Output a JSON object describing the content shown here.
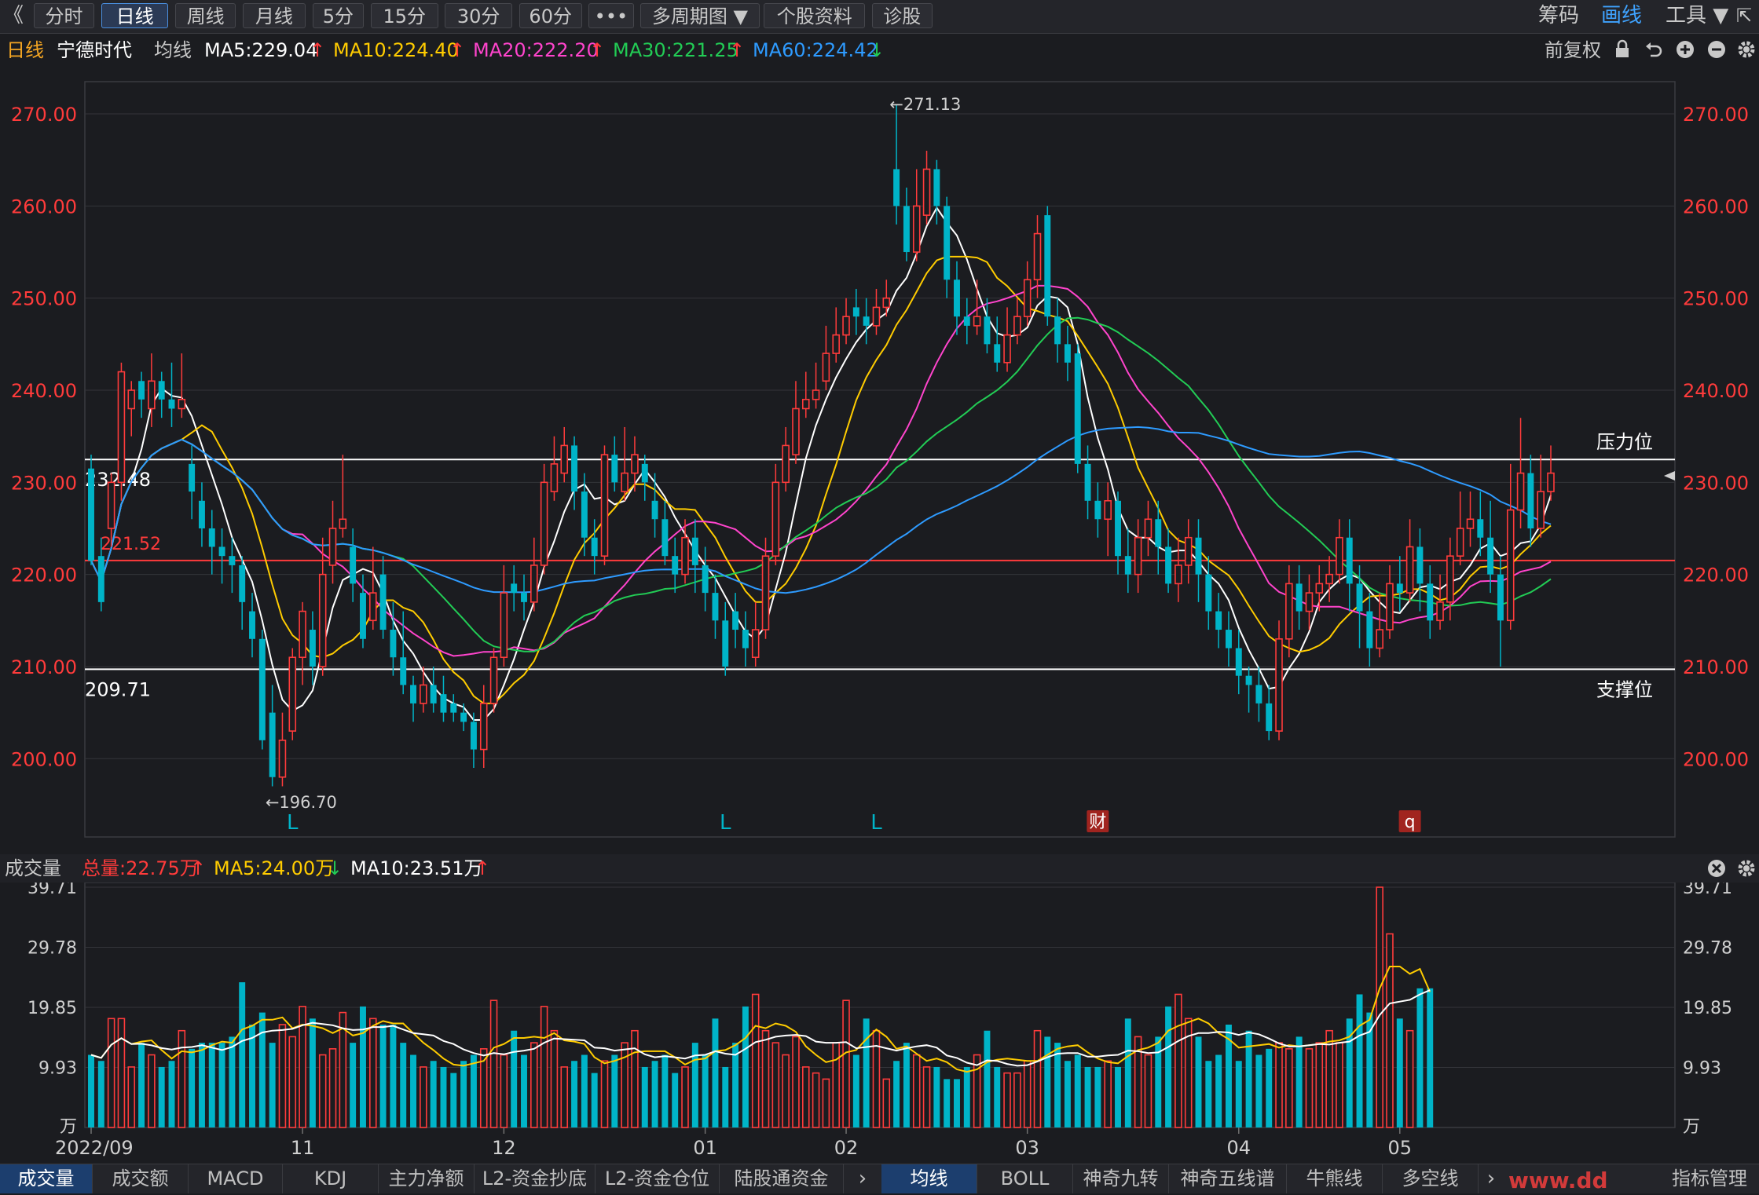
{
  "toolbar": {
    "back_glyph": "《",
    "buttons": [
      "分时",
      "日线",
      "周线",
      "月线",
      "5分",
      "15分",
      "30分",
      "60分",
      "•••",
      "多周期图 ▼",
      "个股资料",
      "诊股"
    ],
    "active_index": 1,
    "right": [
      "筹码",
      "画线",
      "工具 ▼"
    ],
    "right_active_index": 1
  },
  "info": {
    "period": "日线",
    "stock_name": "宁德时代",
    "ma_label": "均线",
    "ma5": "MA5:229.04",
    "ma10": "MA10:224.40",
    "ma20": "MA20:222.20",
    "ma30": "MA30:221.25",
    "ma60": "MA60:224.42",
    "adjust": "前复权"
  },
  "volume_info": {
    "label": "成交量",
    "total": "总量:22.75万",
    "ma5": "MA5:24.00万",
    "ma10": "MA10:23.51万"
  },
  "bottom_tabs_left": [
    "成交量",
    "成交额",
    "MACD",
    "KDJ",
    "主力净额",
    "L2-资金抄底",
    "L2-资金仓位",
    "陆股通资金"
  ],
  "bottom_tabs_right": [
    "均线",
    "BOLL",
    "神奇九转",
    "神奇五线谱",
    "牛熊线",
    "多空线"
  ],
  "bottom_tab_extra": "指标管理",
  "watermark": "www.dd",
  "colors": {
    "up": "#ff3b3b",
    "down": "#00b4c8",
    "ma5": "#ffffff",
    "ma10": "#ffcc00",
    "ma20": "#ff44cc",
    "ma30": "#22cc55",
    "ma60": "#2e9bff",
    "price_axis": "#ff3b3b"
  },
  "chart_data": [
    {
      "type": "candlestick",
      "y_ticks": [
        "270.00",
        "260.00",
        "250.00",
        "240.00",
        "230.00",
        "220.00",
        "210.00",
        "200.00"
      ],
      "ylim": [
        191.5,
        273.5
      ],
      "x_ticks": [
        {
          "label": "2022/09",
          "index": 0
        },
        {
          "label": "11",
          "index": 21
        },
        {
          "label": "12",
          "index": 41
        },
        {
          "label": "01",
          "index": 61
        },
        {
          "label": "02",
          "index": 75
        },
        {
          "label": "03",
          "index": 93
        },
        {
          "label": "04",
          "index": 114
        },
        {
          "label": "05",
          "index": 130
        }
      ],
      "candles": [
        [
          231.5,
          221.5,
          233,
          221
        ],
        [
          222,
          217,
          224,
          216
        ],
        [
          225,
          230,
          231,
          223
        ],
        [
          230,
          242,
          243,
          228
        ],
        [
          238,
          240,
          241,
          235
        ],
        [
          241,
          239,
          242,
          237
        ],
        [
          238,
          241,
          244,
          236
        ],
        [
          241,
          239,
          242,
          237
        ],
        [
          239,
          238,
          243,
          236
        ],
        [
          238,
          239,
          244,
          237
        ],
        [
          232,
          229,
          234,
          226
        ],
        [
          228,
          225,
          230,
          223
        ],
        [
          225,
          223,
          227,
          220
        ],
        [
          223,
          222,
          225,
          219
        ],
        [
          222,
          221,
          224,
          218
        ],
        [
          221,
          217,
          222,
          214
        ],
        [
          216,
          213,
          218,
          211
        ],
        [
          213,
          202,
          214,
          201
        ],
        [
          205,
          198,
          208,
          197
        ],
        [
          198,
          202,
          205,
          197
        ],
        [
          203,
          211,
          212,
          202
        ],
        [
          211,
          216,
          217,
          208
        ],
        [
          214,
          210,
          216,
          208
        ],
        [
          210,
          220,
          224,
          209
        ],
        [
          221,
          225,
          228,
          219
        ],
        [
          225,
          226,
          233,
          224
        ],
        [
          223,
          219,
          225,
          217
        ],
        [
          218,
          213,
          220,
          212
        ],
        [
          215,
          218,
          223,
          214
        ],
        [
          220,
          214,
          222,
          213
        ],
        [
          214,
          211,
          217,
          209
        ],
        [
          211,
          208,
          216,
          207
        ],
        [
          208,
          206,
          209,
          204
        ],
        [
          206,
          208,
          210,
          205
        ],
        [
          208,
          206,
          210,
          205
        ],
        [
          207,
          205,
          209,
          204
        ],
        [
          206,
          205,
          207,
          204
        ],
        [
          205,
          204,
          206,
          203
        ],
        [
          204,
          201,
          205,
          199
        ],
        [
          201,
          206,
          208,
          199
        ],
        [
          206,
          211,
          212,
          205
        ],
        [
          211,
          218,
          221,
          210
        ],
        [
          219,
          218,
          221,
          216
        ],
        [
          218,
          217,
          220,
          215
        ],
        [
          217,
          221,
          224,
          216
        ],
        [
          221,
          230,
          232,
          220
        ],
        [
          229,
          232,
          235,
          228
        ],
        [
          231,
          234,
          236,
          230
        ],
        [
          234,
          229,
          235,
          227
        ],
        [
          229,
          224,
          231,
          222
        ],
        [
          224,
          222,
          226,
          220
        ],
        [
          222,
          233,
          234,
          221
        ],
        [
          233,
          230,
          235,
          229
        ],
        [
          229,
          231,
          236,
          228
        ],
        [
          231,
          233,
          235,
          229
        ],
        [
          232,
          230,
          233,
          228
        ],
        [
          228,
          226,
          231,
          224
        ],
        [
          226,
          222,
          228,
          221
        ],
        [
          222,
          220,
          224,
          218
        ],
        [
          220,
          224,
          226,
          219
        ],
        [
          224,
          221,
          226,
          218
        ],
        [
          221,
          218,
          223,
          216
        ],
        [
          218,
          215,
          220,
          213
        ],
        [
          215,
          210,
          217,
          209
        ],
        [
          216,
          214,
          218,
          212
        ],
        [
          214,
          212,
          216,
          210
        ],
        [
          211,
          214,
          217,
          210
        ],
        [
          214,
          222,
          224,
          213
        ],
        [
          222,
          230,
          232,
          221
        ],
        [
          230,
          234,
          236,
          229
        ],
        [
          233,
          238,
          241,
          232
        ],
        [
          238,
          239,
          242,
          237
        ],
        [
          239,
          240,
          243,
          238
        ],
        [
          241,
          244,
          247,
          240
        ],
        [
          244,
          246,
          249,
          243
        ],
        [
          246,
          248,
          250,
          245
        ],
        [
          249,
          248,
          251,
          246
        ],
        [
          248,
          247,
          250,
          245
        ],
        [
          247,
          249,
          251,
          246
        ],
        [
          249,
          250,
          252,
          248
        ],
        [
          264,
          260,
          271,
          258
        ],
        [
          260,
          255,
          262,
          254
        ],
        [
          255,
          260,
          264,
          254
        ],
        [
          259,
          264,
          266,
          258
        ],
        [
          264,
          260,
          265,
          258
        ],
        [
          260,
          252,
          261,
          250
        ],
        [
          252,
          248,
          254,
          246
        ],
        [
          248,
          247,
          250,
          245
        ],
        [
          247,
          248,
          252,
          246
        ],
        [
          248,
          245,
          250,
          244
        ],
        [
          245,
          243,
          248,
          242
        ],
        [
          243,
          246,
          249,
          242
        ],
        [
          246,
          248,
          250,
          245
        ],
        [
          248,
          252,
          254,
          247
        ],
        [
          252,
          257,
          259,
          250
        ],
        [
          259,
          248,
          260,
          247
        ],
        [
          248,
          245,
          250,
          243
        ],
        [
          245,
          243,
          247,
          241
        ],
        [
          244,
          232,
          245,
          231
        ],
        [
          232,
          228,
          234,
          226
        ],
        [
          228,
          226,
          230,
          224
        ],
        [
          226,
          228,
          230,
          222
        ],
        [
          228,
          222,
          229,
          220
        ],
        [
          222,
          220,
          225,
          218
        ],
        [
          220,
          224,
          226,
          218
        ],
        [
          224,
          226,
          228,
          222
        ],
        [
          226,
          223,
          228,
          220
        ],
        [
          223,
          219,
          225,
          218
        ],
        [
          219,
          221,
          224,
          217
        ],
        [
          221,
          224,
          226,
          219
        ],
        [
          224,
          220,
          226,
          217
        ],
        [
          220,
          216,
          222,
          214
        ],
        [
          216,
          214,
          218,
          212
        ],
        [
          214,
          212,
          216,
          210
        ],
        [
          212,
          209,
          214,
          207
        ],
        [
          209,
          208,
          210,
          205
        ],
        [
          208,
          206,
          210,
          204
        ],
        [
          206,
          203,
          208,
          202
        ],
        [
          203,
          213,
          215,
          202
        ],
        [
          213,
          219,
          221,
          211
        ],
        [
          219,
          216,
          221,
          214
        ],
        [
          216,
          218,
          220,
          214
        ],
        [
          218,
          219,
          221,
          216
        ],
        [
          219,
          220,
          222,
          217
        ],
        [
          220,
          224,
          226,
          219
        ],
        [
          224,
          219,
          226,
          216
        ],
        [
          219,
          216,
          221,
          212
        ],
        [
          216,
          212,
          218,
          210
        ],
        [
          212,
          214,
          218,
          211
        ],
        [
          214,
          219,
          221,
          213
        ],
        [
          219,
          218,
          222,
          216
        ],
        [
          218,
          223,
          226,
          217
        ],
        [
          223,
          219,
          225,
          216
        ],
        [
          219,
          215,
          221,
          213
        ],
        [
          215,
          217,
          220,
          214
        ],
        [
          217,
          222,
          224,
          215
        ],
        [
          222,
          225,
          229,
          221
        ],
        [
          225,
          226,
          229,
          223
        ],
        [
          226,
          224,
          229,
          222
        ],
        [
          224,
          220,
          228,
          218
        ],
        [
          220,
          215,
          222,
          210
        ],
        [
          215,
          227,
          232,
          214
        ],
        [
          227,
          231,
          237,
          225
        ],
        [
          231,
          225,
          233,
          223
        ],
        [
          225,
          229,
          233,
          224
        ],
        [
          229,
          231,
          234,
          228
        ]
      ],
      "hlines": [
        {
          "value": 232.48,
          "label": "232.48",
          "right_label": "压力位",
          "color": "#ffffff"
        },
        {
          "value": 221.52,
          "label": "221.52",
          "right_label": "",
          "color": "#ff3b3b"
        },
        {
          "value": 209.71,
          "label": "209.71",
          "right_label": "支撑位",
          "color": "#ffffff"
        }
      ],
      "annotations": [
        {
          "text": "←271.13",
          "index": 79,
          "value": 271.13
        },
        {
          "text": "←196.70",
          "index": 17,
          "value": 196.7
        }
      ],
      "markers": [
        {
          "text": "L",
          "index": 20,
          "type": "letter"
        },
        {
          "text": "L",
          "index": 63,
          "type": "letter"
        },
        {
          "text": "L",
          "index": 78,
          "type": "letter"
        },
        {
          "text": "财",
          "index": 100,
          "type": "badge"
        },
        {
          "text": "q",
          "index": 131,
          "type": "badge"
        }
      ],
      "ma": [
        {
          "name": "MA5",
          "period": 5,
          "color": "#ffffff"
        },
        {
          "name": "MA10",
          "period": 10,
          "color": "#ffcc00"
        },
        {
          "name": "MA20",
          "period": 20,
          "color": "#ff44cc"
        },
        {
          "name": "MA30",
          "period": 30,
          "color": "#22cc55"
        },
        {
          "name": "MA60",
          "period": 60,
          "color": "#2e9bff"
        }
      ]
    },
    {
      "type": "bar",
      "title": "成交量",
      "y_ticks": [
        "39.71",
        "29.78",
        "19.85",
        "9.93",
        "万"
      ],
      "ylim": [
        0,
        39.71
      ],
      "volumes": [
        12,
        11,
        18,
        18,
        10,
        14,
        12,
        10,
        11,
        16,
        13,
        14,
        14,
        14,
        15,
        24,
        17,
        19,
        14,
        17,
        15,
        20,
        18,
        12,
        13,
        19,
        14,
        20,
        18,
        17,
        17,
        14,
        12,
        10,
        11,
        10,
        9,
        11,
        12,
        13,
        21,
        12,
        16,
        12,
        14,
        20,
        16,
        10,
        11,
        12,
        9,
        11,
        12,
        14,
        16,
        10,
        11,
        12,
        9,
        10,
        14,
        12,
        18,
        10,
        14,
        20,
        22,
        16,
        14,
        12,
        15,
        10,
        9,
        8,
        14,
        21,
        12,
        18,
        16,
        8,
        11,
        14,
        12,
        10,
        10,
        8,
        8,
        10,
        12,
        16,
        10,
        9,
        9,
        11,
        16,
        15,
        14,
        11,
        12,
        10,
        10,
        11,
        10,
        18,
        15,
        12,
        15,
        20,
        22,
        18,
        15,
        11,
        12,
        17,
        11,
        16,
        12,
        13,
        14,
        13,
        15,
        13,
        14,
        16,
        14,
        18,
        22,
        19,
        42,
        32,
        18,
        16,
        23,
        23
      ],
      "volume_direction": "from candles (close >= open is up)"
    }
  ]
}
